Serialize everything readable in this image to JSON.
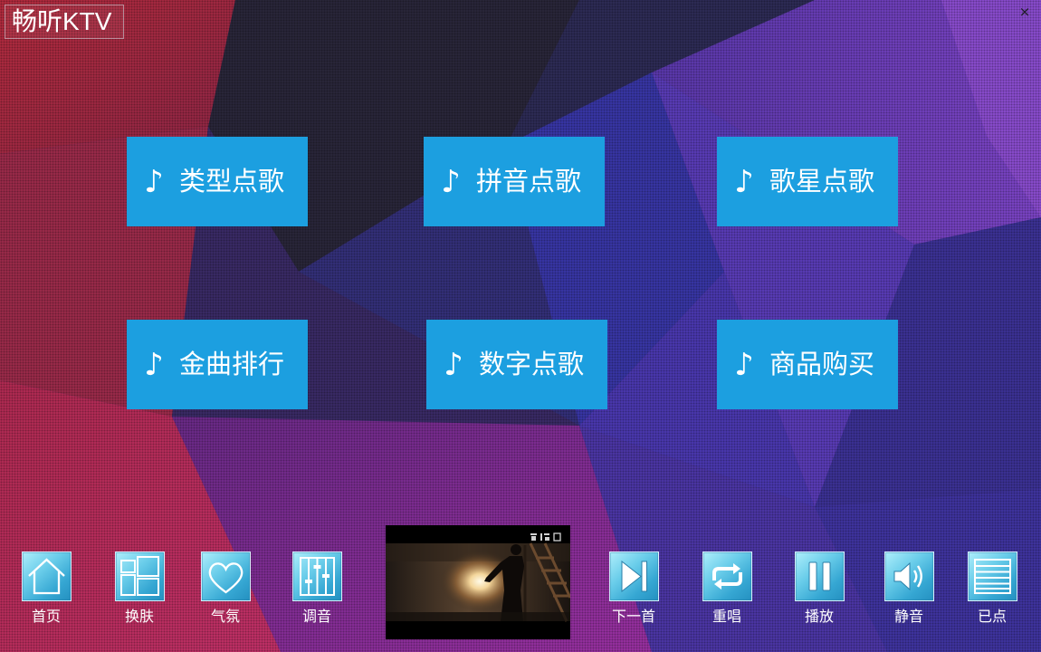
{
  "window": {
    "title": "畅听KTV",
    "close_glyph": "×"
  },
  "colors": {
    "button_bg": "#1c9fe0",
    "text": "#ffffff"
  },
  "menu": {
    "note_glyph": "♪",
    "items": [
      {
        "label": "类型点歌"
      },
      {
        "label": "拼音点歌"
      },
      {
        "label": "歌星点歌"
      },
      {
        "label": "金曲排行"
      },
      {
        "label": "数字点歌"
      },
      {
        "label": "商品购买"
      }
    ]
  },
  "toolbar": {
    "left": [
      {
        "label": "首页",
        "icon": "home-icon"
      },
      {
        "label": "换肤",
        "icon": "skin-layout-icon"
      },
      {
        "label": "气氛",
        "icon": "heart-icon"
      },
      {
        "label": "调音",
        "icon": "equalizer-icon"
      }
    ],
    "right": [
      {
        "label": "下一首",
        "icon": "next-track-icon"
      },
      {
        "label": "重唱",
        "icon": "repeat-icon"
      },
      {
        "label": "播放",
        "icon": "pause-icon"
      },
      {
        "label": "静音",
        "icon": "volume-icon"
      },
      {
        "label": "已点",
        "icon": "playlist-icon"
      }
    ]
  }
}
